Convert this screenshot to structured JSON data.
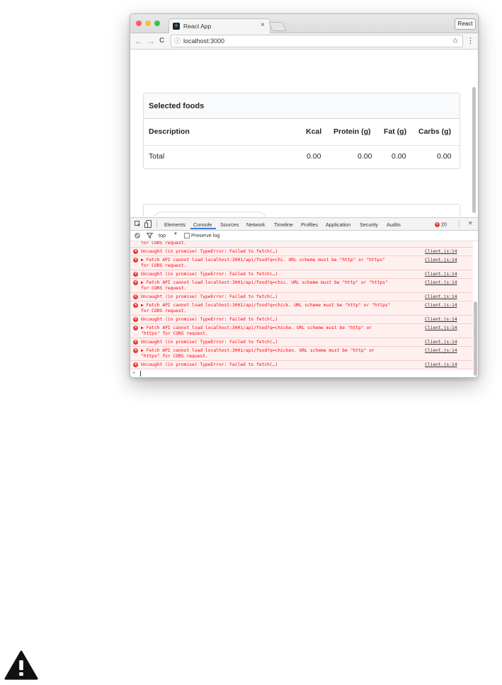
{
  "browser": {
    "tab_title": "React App",
    "tab_close": "×",
    "extension_button": "React",
    "address": "localhost:3000",
    "back": "←",
    "forward": "→",
    "reload": "C",
    "info_icon": "ⓘ",
    "star": "☆",
    "menu": "⋮"
  },
  "app": {
    "table_title": "Selected foods",
    "columns": [
      "Description",
      "Kcal",
      "Protein (g)",
      "Fat (g)",
      "Carbs (g)"
    ],
    "total_row": [
      "Total",
      "0.00",
      "0.00",
      "0.00",
      "0.00"
    ]
  },
  "devtools": {
    "tabs": [
      "Elements",
      "Console",
      "Sources",
      "Network",
      "Timeline",
      "Profiles",
      "Application",
      "Security",
      "Audits"
    ],
    "active_tab": "Console",
    "error_count": "20",
    "close": "✕",
    "context": "top",
    "preserve_log": "Preserve log",
    "messages": [
      {
        "text": "for CORS request.",
        "source": "",
        "icon": false
      },
      {
        "text": "Uncaught (in promise) TypeError: Failed to fetch(…)",
        "source": "Client.js:14",
        "icon": true
      },
      {
        "text": "▶ Fetch API cannot load localhost:3001/api/food?q=chi. URL scheme must be \"http\" or \"https\"\nfor CORS request.",
        "source": "Client.js:14",
        "icon": true
      },
      {
        "text": "Uncaught (in promise) TypeError: Failed to fetch(…)",
        "source": "Client.js:14",
        "icon": true
      },
      {
        "text": "▶ Fetch API cannot load localhost:3001/api/food?q=chic. URL scheme must be \"http\" or \"https\"\nfor CORS request.",
        "source": "Client.js:14",
        "icon": true
      },
      {
        "text": "Uncaught (in promise) TypeError: Failed to fetch(…)",
        "source": "Client.js:14",
        "icon": true
      },
      {
        "text": "▶ Fetch API cannot load localhost:3001/api/food?q=chick. URL scheme must be \"http\" or \"https\"\nfor CORS request.",
        "source": "Client.js:14",
        "icon": true
      },
      {
        "text": "Uncaught (in promise) TypeError: Failed to fetch(…)",
        "source": "Client.js:14",
        "icon": true
      },
      {
        "text": "▶ Fetch API cannot load localhost:3001/api/food?q=chicke. URL scheme must be \"http\" or\n\"https\" for CORS request.",
        "source": "Client.js:14",
        "icon": true
      },
      {
        "text": "Uncaught (in promise) TypeError: Failed to fetch(…)",
        "source": "Client.js:14",
        "icon": true
      },
      {
        "text": "▶ Fetch API cannot load localhost:3001/api/food?q=chicken. URL scheme must be \"http\" or\n\"https\" for CORS request.",
        "source": "Client.js:14",
        "icon": true
      },
      {
        "text": "Uncaught (in promise) TypeError: Failed to fetch(…)",
        "source": "Client.js:14",
        "icon": true
      }
    ],
    "prompt_symbol": ">"
  },
  "colors": {
    "error_text": "#ff0000",
    "error_bg": "#fff0f0",
    "traffic_red": "#fc605c",
    "traffic_yellow": "#fdbc40",
    "traffic_green": "#34c84a",
    "active_tab_underline": "#3879d9",
    "warning_icon": "#111111"
  },
  "icons": [
    "warning-icon",
    "inspect-icon",
    "device-icon",
    "clear-console-icon",
    "filter-icon",
    "react-favicon"
  ]
}
